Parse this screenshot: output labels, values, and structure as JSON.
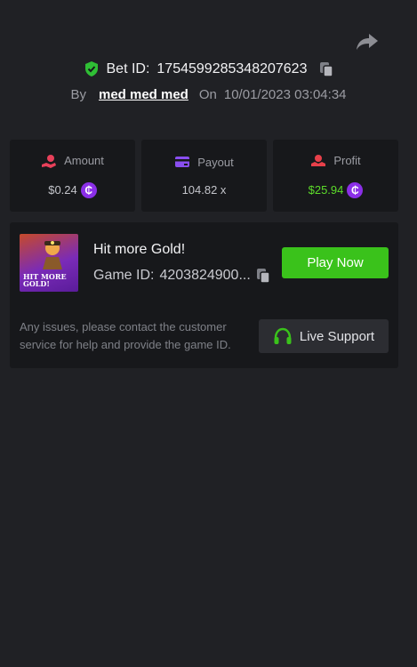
{
  "header": {
    "bet_id_label": "Bet ID:",
    "bet_id": "1754599285348207623",
    "by_label": "By",
    "username": "med med med",
    "on_label": "On",
    "datetime": "10/01/2023 03:04:34"
  },
  "stats": {
    "amount": {
      "label": "Amount",
      "value": "$0.24",
      "icon": "hand-coins-icon"
    },
    "payout": {
      "label": "Payout",
      "value": "104.82 x",
      "icon": "card-icon"
    },
    "profit": {
      "label": "Profit",
      "value": "$25.94",
      "icon": "hand-money-icon"
    },
    "coin_symbol": "₵"
  },
  "game": {
    "name": "Hit more Gold!",
    "thumbnail_text_line1": "HIT MORE",
    "thumbnail_text_line2": "GOLD!",
    "id_label": "Game ID:",
    "id_value": "4203824900...",
    "play_label": "Play Now",
    "note": "Any issues, please contact the customer service for help and provide the game ID.",
    "support_label": "Live Support"
  },
  "colors": {
    "background": "#202125",
    "card": "#17181b",
    "accent_green": "#3ac21b",
    "profit_green": "#5ddc2a",
    "coin_purple": "#8b2fe8"
  }
}
